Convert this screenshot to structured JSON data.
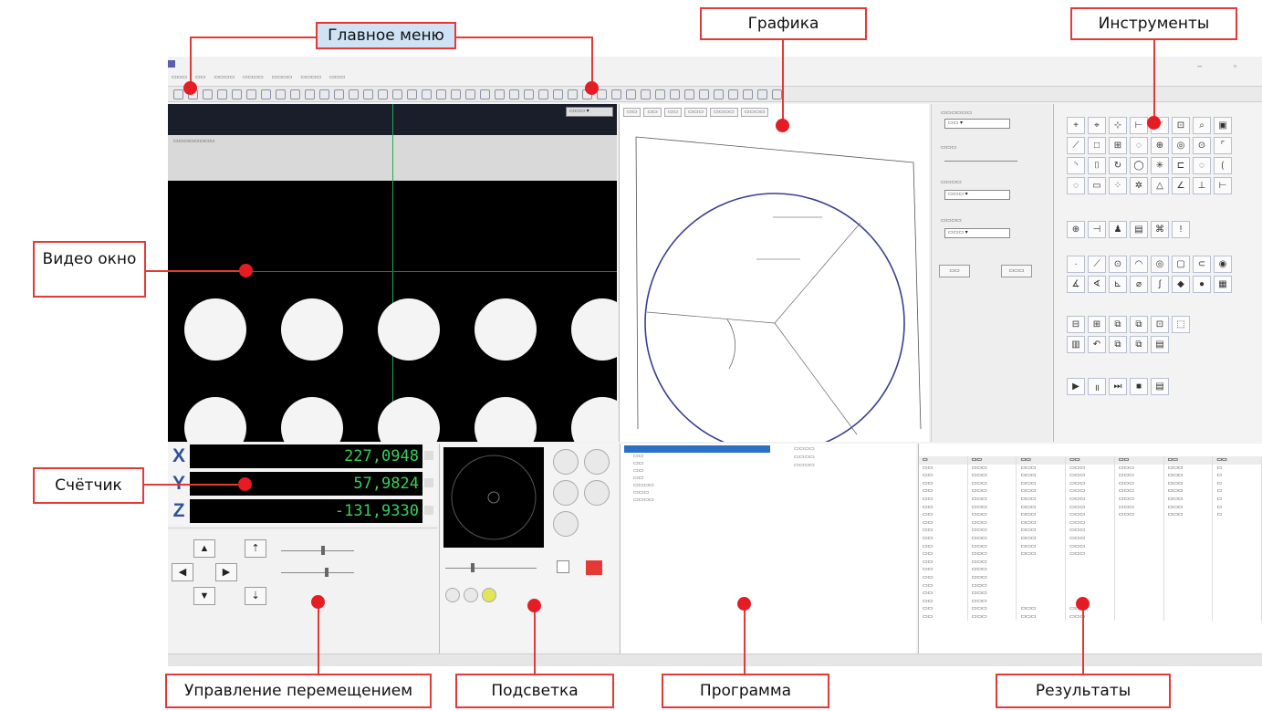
{
  "callouts": {
    "main_menu": "Главное меню",
    "graphics": "Графика",
    "tools": "Инструменты",
    "video": "Видео окно",
    "counter": "Счётчик",
    "motion": "Управление перемещением",
    "lighting": "Подсветка",
    "program": "Программа",
    "results": "Результаты"
  },
  "counter": {
    "x_label": "X",
    "x_value": "227,0948",
    "y_label": "Y",
    "y_value": "57,9824",
    "z_label": "Z",
    "z_value": "-131,9330"
  },
  "colors": {
    "callout_border": "#e53935",
    "marker_dot": "#e51c23",
    "counter_digits": "#36d05a",
    "axis_letters": "#2f52a0",
    "circle_stroke": "#3a3f8f"
  }
}
